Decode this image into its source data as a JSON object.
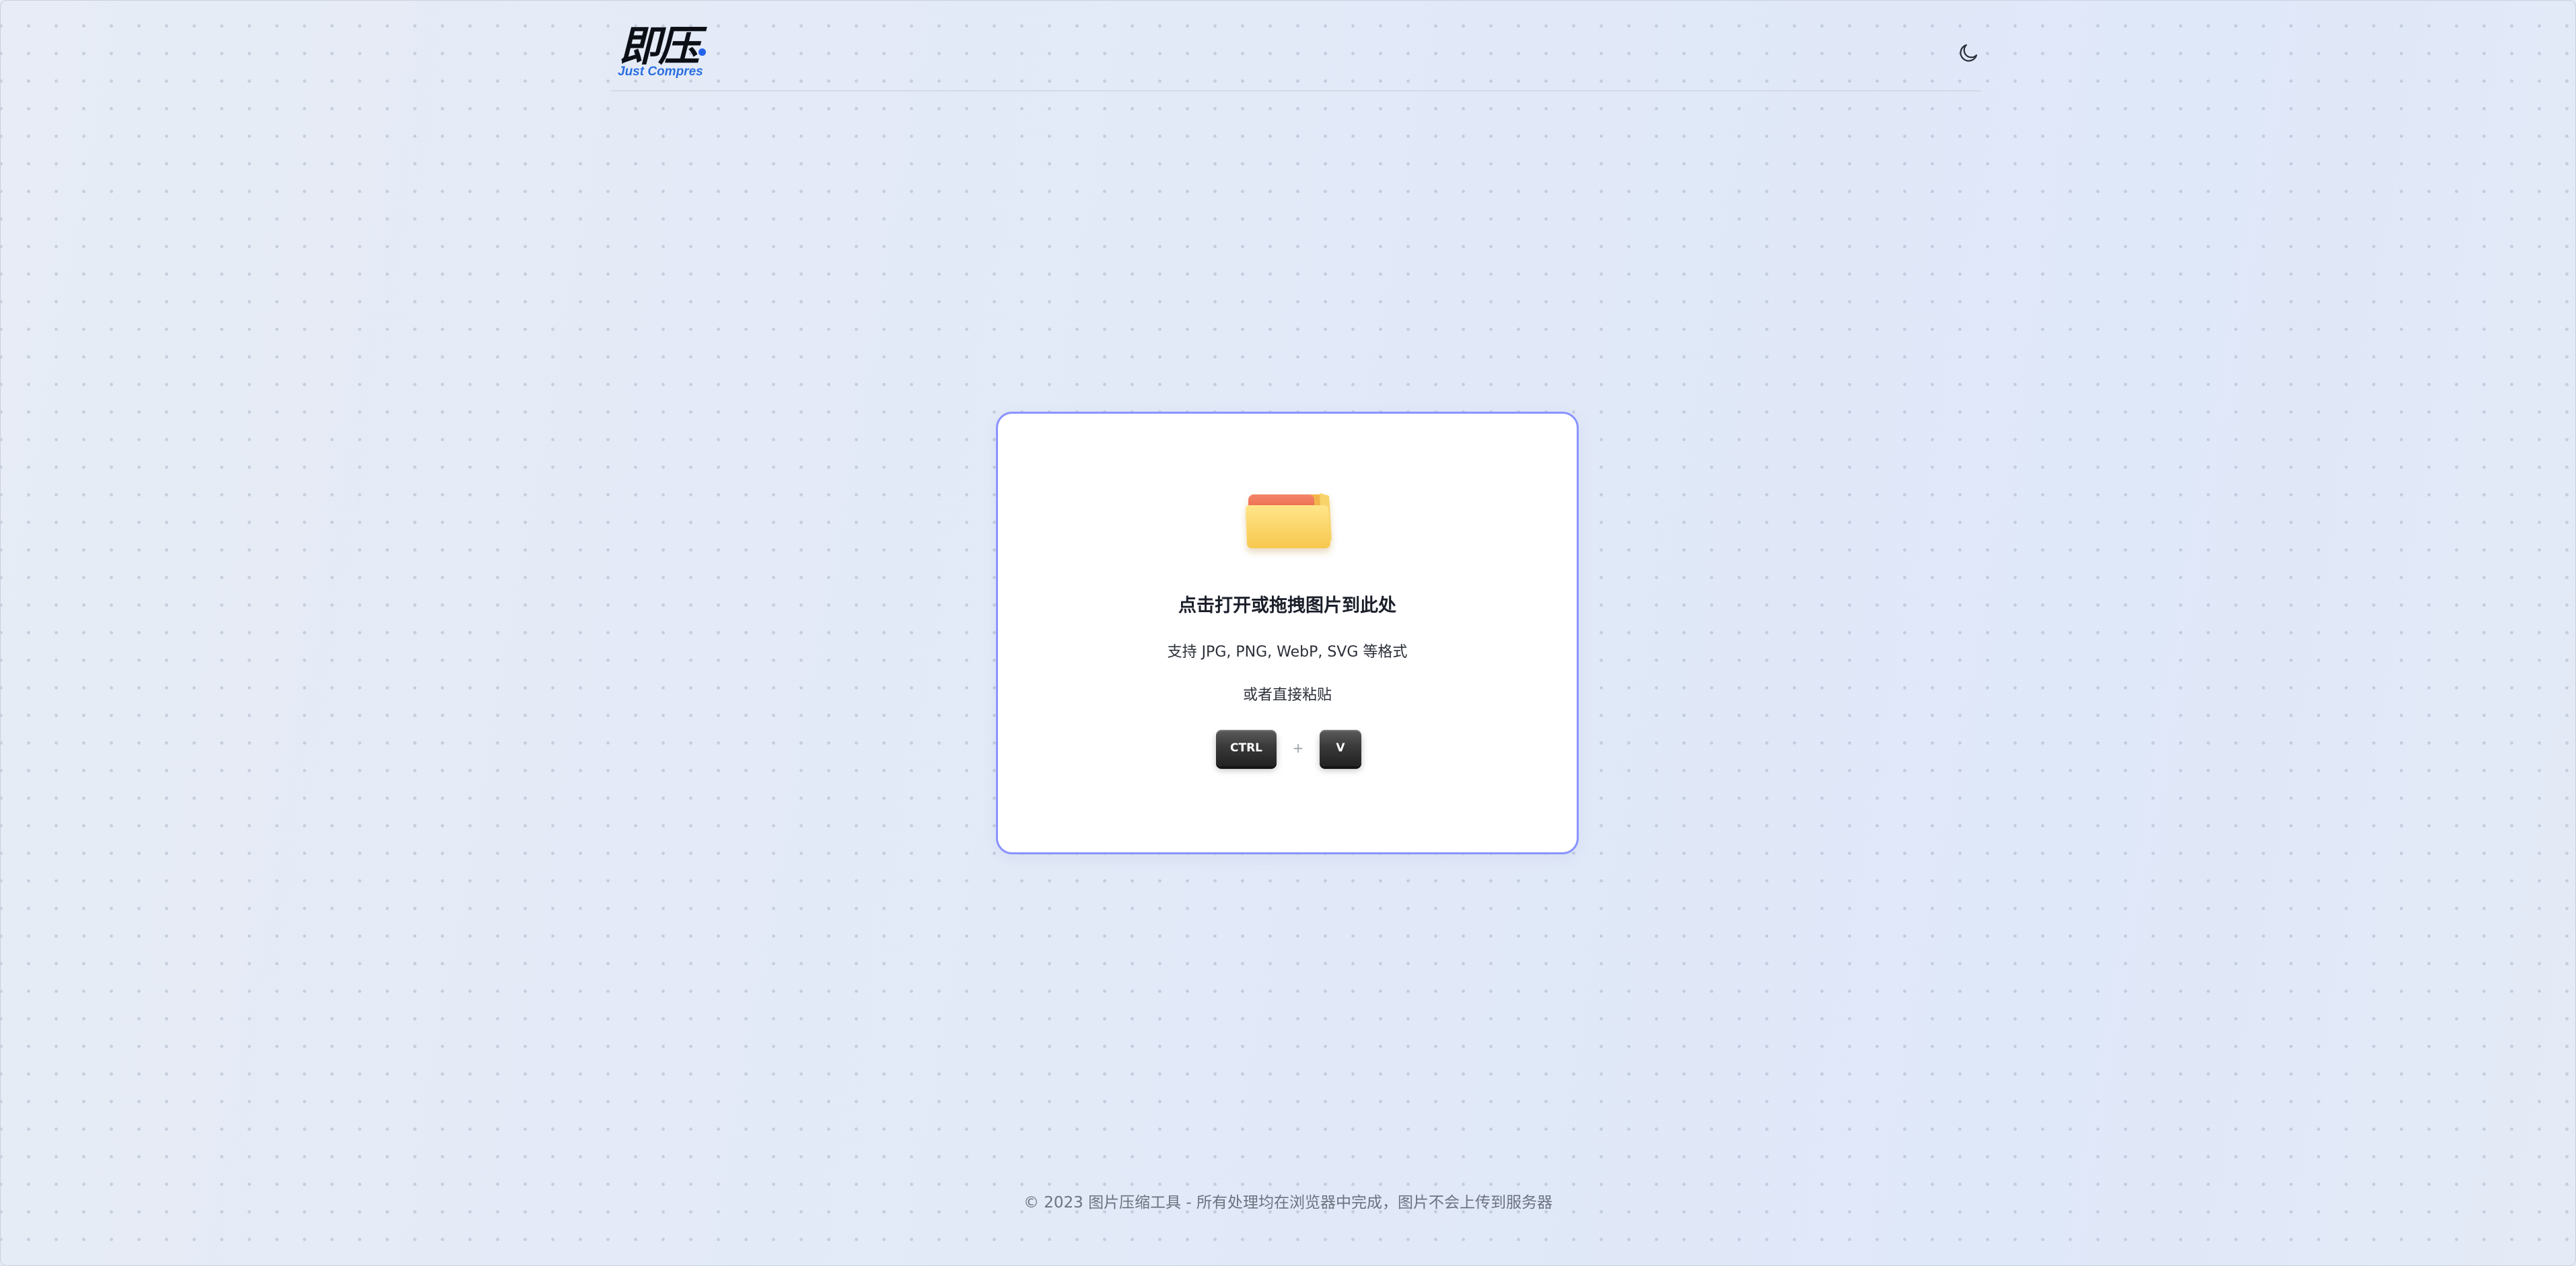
{
  "header": {
    "logo_text": "即压",
    "logo_subtitle": "Just Compres",
    "theme_toggle_icon": "moon-icon"
  },
  "upload": {
    "icon": "folder-icon",
    "title": "点击打开或拖拽图片到此处",
    "formats": "支持 JPG, PNG, WebP, SVG 等格式",
    "paste_hint": "或者直接粘贴",
    "shortcut": {
      "key1": "CTRL",
      "separator": "+",
      "key2": "V"
    }
  },
  "footer": {
    "text": "© 2023 图片压缩工具 - 所有处理均在浏览器中完成，图片不会上传到服务器"
  },
  "colors": {
    "accent_border": "#8a93ff",
    "brand_blue": "#2563eb",
    "background": "#e3eaf6"
  }
}
